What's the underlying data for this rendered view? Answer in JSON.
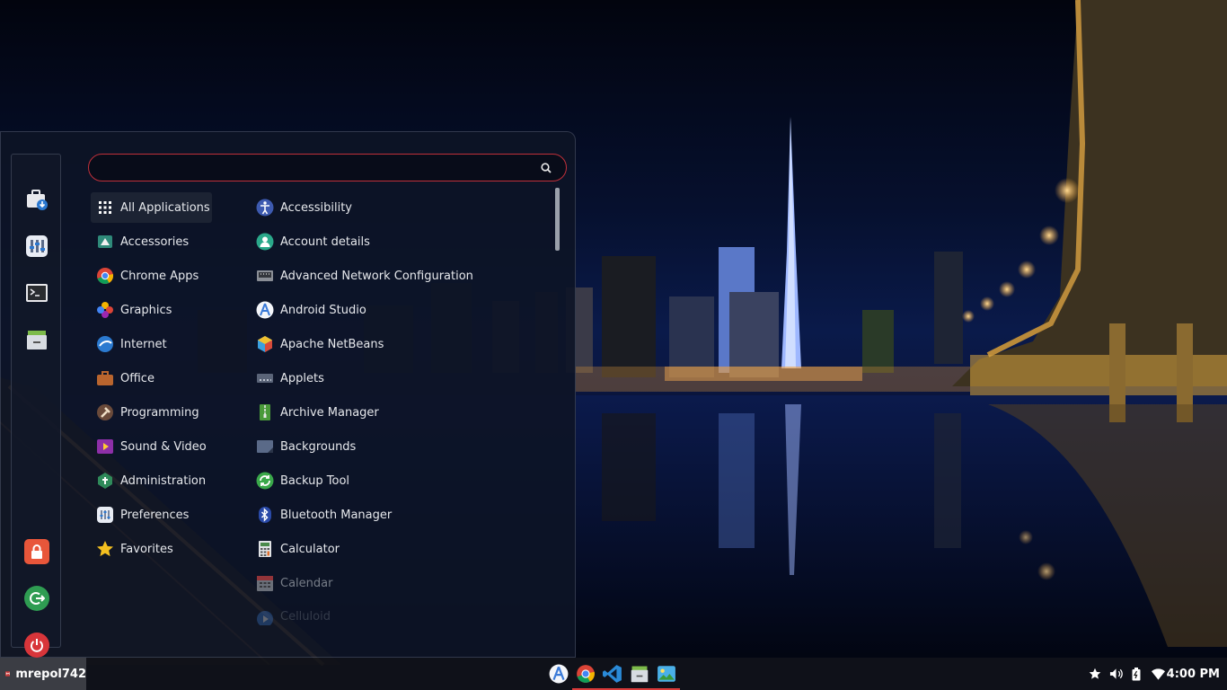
{
  "search": {
    "value": "",
    "placeholder": ""
  },
  "favorites": [
    {
      "name": "software-manager",
      "icon": "bag-download-icon"
    },
    {
      "name": "system-settings",
      "icon": "sliders-icon"
    },
    {
      "name": "terminal",
      "icon": "terminal-icon"
    },
    {
      "name": "files",
      "icon": "file-cabinet-icon"
    },
    {
      "name": "lock-screen",
      "icon": "lock-icon"
    },
    {
      "name": "logout",
      "icon": "logout-icon"
    },
    {
      "name": "shutdown",
      "icon": "power-icon"
    }
  ],
  "categories": [
    {
      "label": "All Applications",
      "icon": "grid-icon",
      "active": true
    },
    {
      "label": "Accessories",
      "icon": "accessories-icon"
    },
    {
      "label": "Chrome Apps",
      "icon": "chrome-icon"
    },
    {
      "label": "Graphics",
      "icon": "graphics-icon"
    },
    {
      "label": "Internet",
      "icon": "internet-icon"
    },
    {
      "label": "Office",
      "icon": "briefcase-icon"
    },
    {
      "label": "Programming",
      "icon": "hammer-icon"
    },
    {
      "label": "Sound & Video",
      "icon": "media-icon"
    },
    {
      "label": "Administration",
      "icon": "admin-icon"
    },
    {
      "label": "Preferences",
      "icon": "preferences-icon"
    },
    {
      "label": "Favorites",
      "icon": "star-icon"
    }
  ],
  "apps": [
    {
      "label": "Accessibility",
      "icon": "accessibility-icon"
    },
    {
      "label": "Account details",
      "icon": "account-icon"
    },
    {
      "label": "Advanced Network Configuration",
      "icon": "network-icon"
    },
    {
      "label": "Android Studio",
      "icon": "android-studio-icon"
    },
    {
      "label": "Apache NetBeans",
      "icon": "netbeans-icon"
    },
    {
      "label": "Applets",
      "icon": "applets-icon"
    },
    {
      "label": "Archive Manager",
      "icon": "archive-icon"
    },
    {
      "label": "Backgrounds",
      "icon": "backgrounds-icon"
    },
    {
      "label": "Backup Tool",
      "icon": "backup-icon"
    },
    {
      "label": "Bluetooth Manager",
      "icon": "bluetooth-icon"
    },
    {
      "label": "Calculator",
      "icon": "calculator-icon"
    },
    {
      "label": "Calendar",
      "icon": "calendar-icon"
    },
    {
      "label": "Celluloid",
      "icon": "celluloid-icon"
    }
  ],
  "taskbar": {
    "username": "mrepol742",
    "tasks": [
      {
        "name": "android-studio",
        "running": false
      },
      {
        "name": "chrome",
        "running": true
      },
      {
        "name": "vscode",
        "running": true
      },
      {
        "name": "files",
        "running": true
      },
      {
        "name": "image-viewer",
        "running": true
      }
    ],
    "tray": [
      "star-icon",
      "volume-icon",
      "battery-icon",
      "wifi-icon"
    ],
    "clock": "4:00 PM"
  },
  "colors": {
    "accent": "#d83a3a",
    "menu_bg": "#0d1426",
    "text": "#e6e8ec"
  }
}
